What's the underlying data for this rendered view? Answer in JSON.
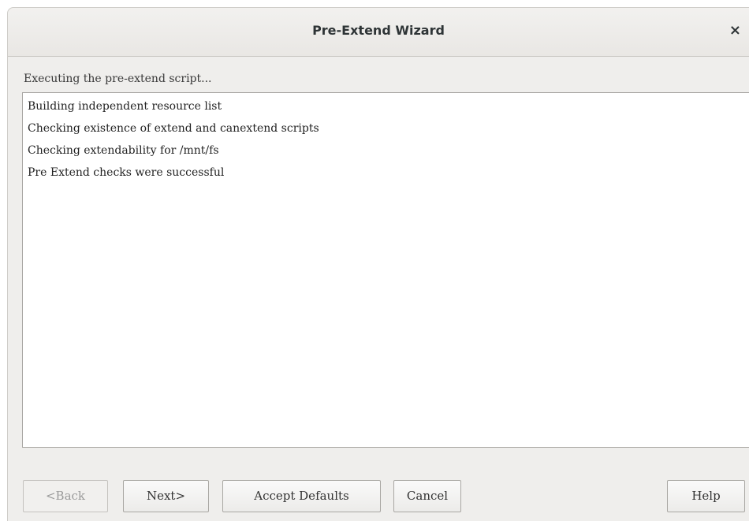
{
  "window": {
    "title": "Pre-Extend Wizard",
    "close_glyph": "×",
    "close_icon": "close-icon"
  },
  "status_text": "Executing the pre-extend script...",
  "log_lines": [
    "Building independent resource list",
    "Checking existence of extend and canextend scripts",
    "Checking extendability for /mnt/fs",
    "Pre Extend checks were successful"
  ],
  "buttons": {
    "back": "<Back",
    "next": "Next>",
    "accept_defaults": "Accept Defaults",
    "cancel": "Cancel",
    "help": "Help"
  }
}
